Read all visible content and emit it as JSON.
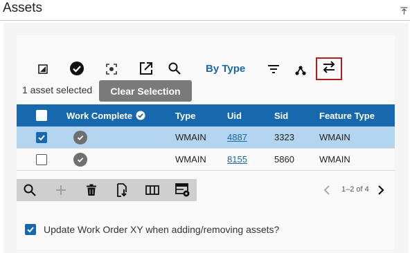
{
  "header": {
    "title": "Assets",
    "collapse_icon": "collapse-up-icon"
  },
  "toolbar": {
    "icons": [
      "edit-image-icon",
      "check-circle-icon",
      "focus-icon",
      "open-external-icon",
      "search-icon",
      "filter-icon",
      "hierarchy-icon",
      "swap-icon"
    ],
    "by_type_label": "By Type"
  },
  "selection": {
    "count_text": "1 asset selected",
    "clear_label": "Clear Selection"
  },
  "table": {
    "columns": [
      "Work Complete",
      "Type",
      "Uid",
      "Sid",
      "Feature Type"
    ],
    "rows": [
      {
        "selected": true,
        "type": "WMAIN",
        "uid": "4887",
        "sid": "3323",
        "feature_type": "WMAIN"
      },
      {
        "selected": false,
        "type": "WMAIN",
        "uid": "8155",
        "sid": "5860",
        "feature_type": "WMAIN"
      }
    ]
  },
  "bottom_toolbar": {
    "icons": [
      "search-icon",
      "add-icon",
      "delete-icon",
      "import-icon",
      "columns-icon",
      "table-settings-icon"
    ]
  },
  "pager": {
    "text": "1–2 of 4"
  },
  "update_option": {
    "checked": true,
    "label": "Update Work Order XY when adding/removing assets?"
  },
  "colors": {
    "header_blue": "#1768ac",
    "selected_row": "#b3d5ef",
    "highlight_border": "#b71c1c"
  }
}
